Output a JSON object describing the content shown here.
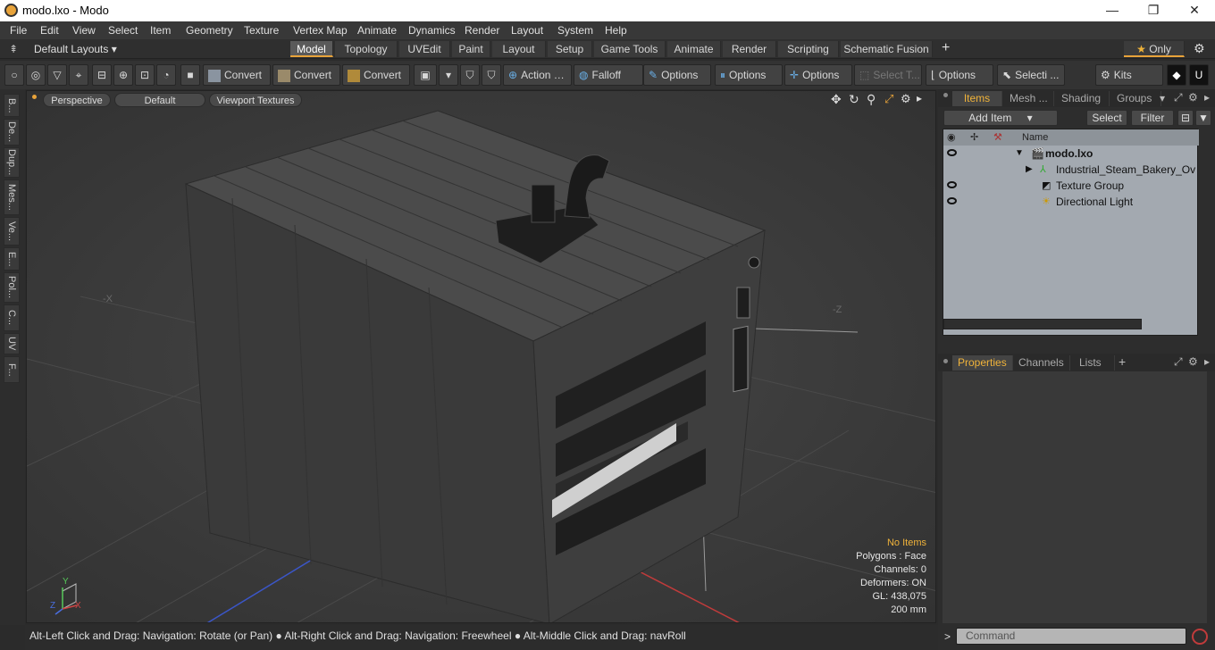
{
  "window": {
    "title": "modo.lxo - Modo",
    "minimize": "—",
    "maximize": "❐",
    "close": "✕"
  },
  "menu": [
    "File",
    "Edit",
    "View",
    "Select",
    "Item",
    "Geometry",
    "Texture",
    "Vertex Map",
    "Animate",
    "Dynamics",
    "Render",
    "Layout",
    "System",
    "Help"
  ],
  "layouts": {
    "label": "Default Layouts",
    "tabs": [
      "Model",
      "Topology",
      "UVEdit",
      "Paint",
      "Layout",
      "Setup",
      "Game Tools",
      "Animate",
      "Render",
      "Scripting",
      "Schematic Fusion"
    ],
    "active": "Model",
    "add": "+",
    "only": "Only"
  },
  "toolbar": {
    "convert1": "Convert",
    "convert2": "Convert",
    "convert3": "Convert",
    "action": "Action",
    "falloff": "Falloff",
    "options1": "Options",
    "options2": "Options",
    "options3": "Options",
    "options4": "Options",
    "select_t": "Select T...",
    "selecti": "Selecti ...",
    "kits": "Kits"
  },
  "lefttabs": [
    "B...",
    "De...",
    "Dup...",
    "Mes...",
    "Ve...",
    "E...",
    "Pol...",
    "C...",
    "UV",
    "F..."
  ],
  "viewport": {
    "perspective": "Perspective",
    "default": "Default",
    "textures": "Viewport Textures",
    "info": {
      "items": "No Items",
      "polygons": "Polygons : Face",
      "channels": "Channels: 0",
      "deformers": "Deformers: ON",
      "gl": "GL: 438,075",
      "units": "200 mm"
    },
    "axes": {
      "y": "Y",
      "z": "Z",
      "x": "X"
    }
  },
  "statusbar": "Alt-Left Click and Drag: Navigation: Rotate (or Pan) ● Alt-Right Click and Drag: Navigation: Freewheel ● Alt-Middle Click and Drag: navRoll",
  "items_panel": {
    "tabs": [
      "Items",
      "Mesh ...",
      "Shading",
      "Groups"
    ],
    "add_item": "Add Item",
    "select": "Select",
    "filter": "Filter",
    "name_col": "Name",
    "tree": [
      {
        "label": "modo.lxo",
        "bold": true,
        "eye": true
      },
      {
        "label": "Industrial_Steam_Bakery_Ov ...",
        "bold": false,
        "eye": false
      },
      {
        "label": "Texture Group",
        "bold": false,
        "eye": true
      },
      {
        "label": "Directional Light",
        "bold": false,
        "eye": true
      }
    ]
  },
  "props_panel": {
    "tabs": [
      "Properties",
      "Channels",
      "Lists"
    ]
  },
  "command": {
    "placeholder": "Command",
    "prompt": ">"
  }
}
